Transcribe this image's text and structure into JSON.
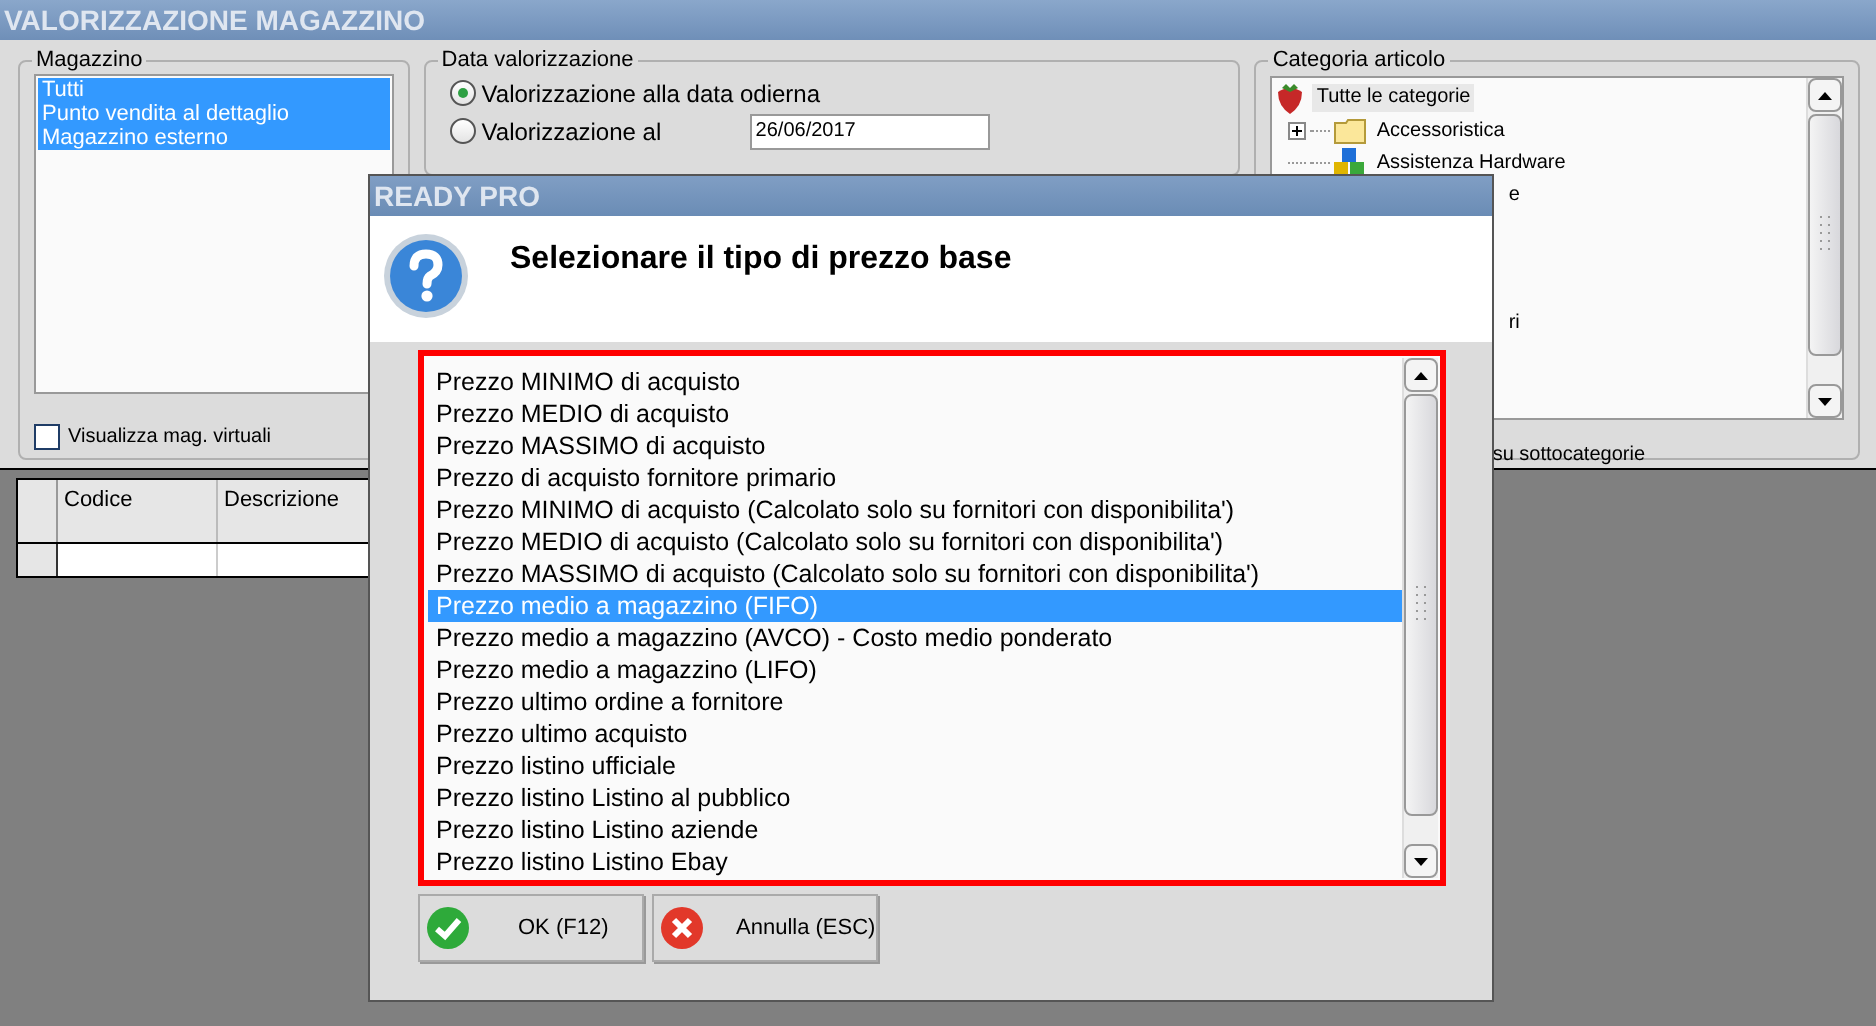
{
  "window": {
    "title": "VALORIZZAZIONE MAGAZZINO"
  },
  "magazzino": {
    "title": "Magazzino",
    "items": [
      {
        "label": "Tutti",
        "selected": true
      },
      {
        "label": "Punto vendita al dettaglio",
        "selected": true
      },
      {
        "label": "Magazzino esterno",
        "selected": true
      }
    ],
    "virtual_checkbox": {
      "label": "Visualizza mag. virtuali",
      "checked": false
    }
  },
  "data_valorizzazione": {
    "title": "Data valorizzazione",
    "options": [
      {
        "label": "Valorizzazione alla data odierna",
        "selected": true
      },
      {
        "label": "Valorizzazione al",
        "selected": false
      }
    ],
    "date_value": "26/06/2017"
  },
  "categoria": {
    "title": "Categoria articolo",
    "tree": [
      {
        "label": "Tutte le categorie",
        "kind": "root",
        "selected": true,
        "children": [
          {
            "label": "Accessoristica",
            "kind": "folder",
            "expandable": true,
            "selected": false
          },
          {
            "label": "Assistenza Hardware",
            "kind": "cubes",
            "expandable": false,
            "selected": false
          },
          {
            "label": "e",
            "kind": "clipped",
            "selected": false
          },
          {
            "label": "ri",
            "kind": "clipped",
            "selected": false
          }
        ]
      }
    ],
    "subcategory_label": "su sottocategorie"
  },
  "grid": {
    "columns": [
      "Codice",
      "Descrizione"
    ]
  },
  "dialog": {
    "title": "READY PRO",
    "message": "Selezionare il tipo di prezzo base",
    "options": [
      {
        "label": "Prezzo MINIMO di acquisto",
        "selected": false
      },
      {
        "label": "Prezzo MEDIO di acquisto",
        "selected": false
      },
      {
        "label": "Prezzo MASSIMO di acquisto",
        "selected": false
      },
      {
        "label": "Prezzo di acquisto fornitore primario",
        "selected": false
      },
      {
        "label": "Prezzo MINIMO di acquisto (Calcolato solo su fornitori con disponibilita')",
        "selected": false
      },
      {
        "label": "Prezzo MEDIO di acquisto (Calcolato solo su fornitori con disponibilita')",
        "selected": false
      },
      {
        "label": "Prezzo MASSIMO di acquisto (Calcolato solo su fornitori con disponibilita')",
        "selected": false
      },
      {
        "label": "Prezzo medio a magazzino (FIFO)",
        "selected": true
      },
      {
        "label": "Prezzo medio a magazzino (AVCO) - Costo medio ponderato",
        "selected": false
      },
      {
        "label": "Prezzo medio a magazzino (LIFO)",
        "selected": false
      },
      {
        "label": "Prezzo ultimo ordine a fornitore",
        "selected": false
      },
      {
        "label": "Prezzo ultimo acquisto",
        "selected": false
      },
      {
        "label": "Prezzo listino ufficiale",
        "selected": false
      },
      {
        "label": "Prezzo listino Listino al pubblico",
        "selected": false
      },
      {
        "label": "Prezzo listino Listino aziende",
        "selected": false
      },
      {
        "label": "Prezzo listino Listino Ebay",
        "selected": false
      }
    ],
    "buttons": [
      {
        "label": "OK (F12)",
        "kind": "ok"
      },
      {
        "label": "Annulla (ESC)",
        "kind": "cancel"
      }
    ]
  }
}
